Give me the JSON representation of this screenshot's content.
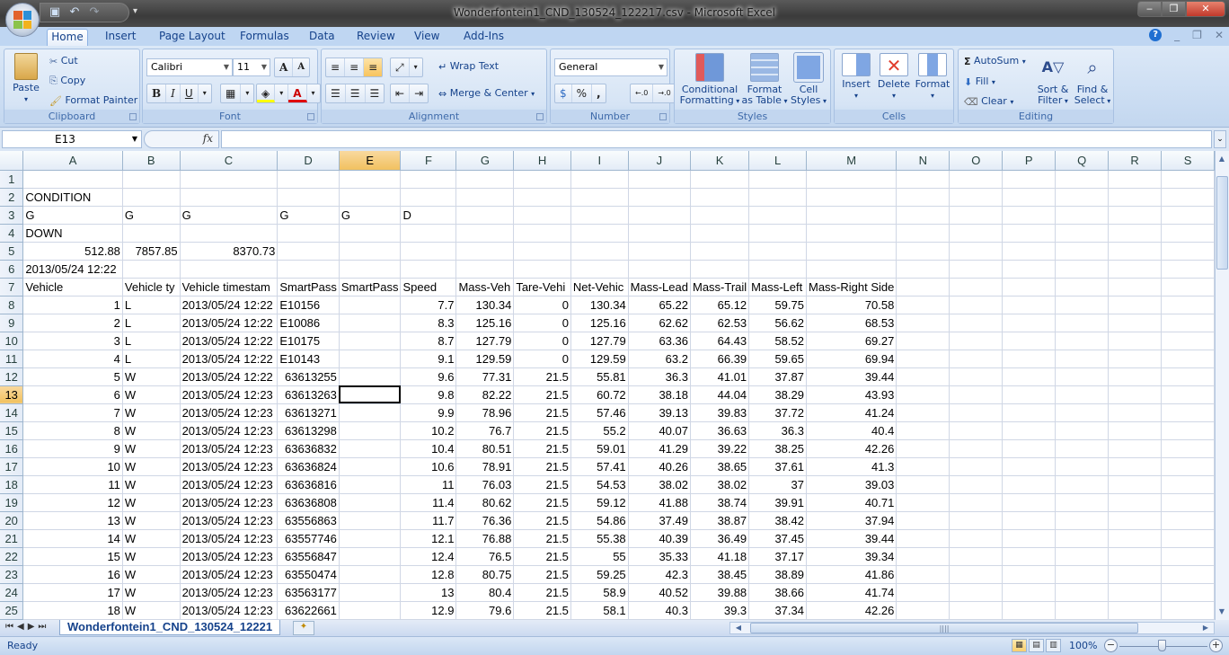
{
  "window": {
    "title": "Wonderfontein1_CND_130524_122217.csv - Microsoft Excel",
    "controls": {
      "minimize": "‒",
      "restore": "❐",
      "close": "✕"
    }
  },
  "quick_access": {
    "save": "save-icon",
    "undo": "undo-icon",
    "redo": "redo-icon",
    "more": "▾"
  },
  "tabs": [
    "Home",
    "Insert",
    "Page Layout",
    "Formulas",
    "Data",
    "Review",
    "View",
    "Add-Ins"
  ],
  "active_tab": "Home",
  "ribbon": {
    "clipboard": {
      "label": "Clipboard",
      "paste": "Paste",
      "cut": "Cut",
      "copy": "Copy",
      "format_painter": "Format Painter"
    },
    "font": {
      "label": "Font",
      "font_name": "Calibri",
      "font_size": "11",
      "grow": "A",
      "shrink": "A",
      "bold": "B",
      "italic": "I",
      "underline": "U"
    },
    "alignment": {
      "label": "Alignment",
      "wrap_text": "Wrap Text",
      "merge_center": "Merge & Center"
    },
    "number": {
      "label": "Number",
      "format": "General",
      "percent": "%",
      "comma": ",",
      "inc_decimal": "←.0 .00",
      "dec_decimal": ".00 →.0"
    },
    "styles": {
      "label": "Styles",
      "conditional": "Conditional",
      "conditional2": "Formatting",
      "format_table": "Format",
      "format_table2": "as Table",
      "cell_styles": "Cell",
      "cell_styles2": "Styles"
    },
    "cells": {
      "label": "Cells",
      "insert": "Insert",
      "delete": "Delete",
      "format": "Format"
    },
    "editing": {
      "label": "Editing",
      "autosum": "AutoSum",
      "fill": "Fill",
      "clear": "Clear",
      "sort": "Sort &",
      "sort2": "Filter",
      "find": "Find &",
      "find2": "Select"
    }
  },
  "formula_bar": {
    "name_box": "E13",
    "fx": "fx",
    "formula": ""
  },
  "columns": [
    "A",
    "B",
    "C",
    "D",
    "E",
    "F",
    "G",
    "H",
    "I",
    "J",
    "K",
    "L",
    "M",
    "N",
    "O",
    "P",
    "Q",
    "R",
    "S"
  ],
  "selected_cell": {
    "col": "E",
    "row": 13
  },
  "rows": [
    {
      "n": "1",
      "cells": [
        "",
        "",
        "",
        "",
        "",
        "",
        "",
        "",
        "",
        "",
        "",
        "",
        ""
      ]
    },
    {
      "n": "2",
      "cells": [
        "CONDITION",
        "",
        "",
        "",
        "",
        "",
        "",
        "",
        "",
        "",
        "",
        "",
        ""
      ]
    },
    {
      "n": "3",
      "cells": [
        "G",
        "G",
        "G",
        "G",
        "G",
        "D",
        "",
        "",
        "",
        "",
        "",
        "",
        ""
      ]
    },
    {
      "n": "4",
      "cells": [
        "DOWN",
        "",
        "",
        "",
        "",
        "",
        "",
        "",
        "",
        "",
        "",
        "",
        ""
      ]
    },
    {
      "n": "5",
      "cells": [
        "512.88",
        "7857.85",
        "8370.73",
        "",
        "",
        "",
        "",
        "",
        "",
        "",
        "",
        "",
        ""
      ]
    },
    {
      "n": "6",
      "cells": [
        " 2013/05/24 12:22",
        "",
        "",
        "",
        "",
        "",
        "",
        "",
        "",
        "",
        "",
        "",
        ""
      ]
    },
    {
      "n": "7",
      "cells": [
        "Vehicle",
        "Vehicle ty",
        "Vehicle timestam",
        "SmartPass",
        "SmartPass",
        "Speed",
        "Mass-Veh",
        "Tare-Vehi",
        "Net-Vehic",
        "Mass-Lead",
        "Mass-Trail",
        "Mass-Left",
        "Mass-Right Side"
      ]
    },
    {
      "n": "8",
      "cells": [
        "1",
        "L",
        "2013/05/24 12:22",
        "E10156",
        "",
        "7.7",
        "130.34",
        "0",
        "130.34",
        "65.22",
        "65.12",
        "59.75",
        "70.58"
      ]
    },
    {
      "n": "9",
      "cells": [
        "2",
        "L",
        "2013/05/24 12:22",
        "E10086",
        "",
        "8.3",
        "125.16",
        "0",
        "125.16",
        "62.62",
        "62.53",
        "56.62",
        "68.53"
      ]
    },
    {
      "n": "10",
      "cells": [
        "3",
        "L",
        "2013/05/24 12:22",
        "E10175",
        "",
        "8.7",
        "127.79",
        "0",
        "127.79",
        "63.36",
        "64.43",
        "58.52",
        "69.27"
      ]
    },
    {
      "n": "11",
      "cells": [
        "4",
        "L",
        "2013/05/24 12:22",
        "E10143",
        "",
        "9.1",
        "129.59",
        "0",
        "129.59",
        "63.2",
        "66.39",
        "59.65",
        "69.94"
      ]
    },
    {
      "n": "12",
      "cells": [
        "5",
        "W",
        "2013/05/24 12:22",
        "63613255",
        "",
        "9.6",
        "77.31",
        "21.5",
        "55.81",
        "36.3",
        "41.01",
        "37.87",
        "39.44"
      ]
    },
    {
      "n": "13",
      "cells": [
        "6",
        "W",
        "2013/05/24 12:23",
        "63613263",
        "",
        "9.8",
        "82.22",
        "21.5",
        "60.72",
        "38.18",
        "44.04",
        "38.29",
        "43.93"
      ]
    },
    {
      "n": "14",
      "cells": [
        "7",
        "W",
        "2013/05/24 12:23",
        "63613271",
        "",
        "9.9",
        "78.96",
        "21.5",
        "57.46",
        "39.13",
        "39.83",
        "37.72",
        "41.24"
      ]
    },
    {
      "n": "15",
      "cells": [
        "8",
        "W",
        "2013/05/24 12:23",
        "63613298",
        "",
        "10.2",
        "76.7",
        "21.5",
        "55.2",
        "40.07",
        "36.63",
        "36.3",
        "40.4"
      ]
    },
    {
      "n": "16",
      "cells": [
        "9",
        "W",
        "2013/05/24 12:23",
        "63636832",
        "",
        "10.4",
        "80.51",
        "21.5",
        "59.01",
        "41.29",
        "39.22",
        "38.25",
        "42.26"
      ]
    },
    {
      "n": "17",
      "cells": [
        "10",
        "W",
        "2013/05/24 12:23",
        "63636824",
        "",
        "10.6",
        "78.91",
        "21.5",
        "57.41",
        "40.26",
        "38.65",
        "37.61",
        "41.3"
      ]
    },
    {
      "n": "18",
      "cells": [
        "11",
        "W",
        "2013/05/24 12:23",
        "63636816",
        "",
        "11",
        "76.03",
        "21.5",
        "54.53",
        "38.02",
        "38.02",
        "37",
        "39.03"
      ]
    },
    {
      "n": "19",
      "cells": [
        "12",
        "W",
        "2013/05/24 12:23",
        "63636808",
        "",
        "11.4",
        "80.62",
        "21.5",
        "59.12",
        "41.88",
        "38.74",
        "39.91",
        "40.71"
      ]
    },
    {
      "n": "20",
      "cells": [
        "13",
        "W",
        "2013/05/24 12:23",
        "63556863",
        "",
        "11.7",
        "76.36",
        "21.5",
        "54.86",
        "37.49",
        "38.87",
        "38.42",
        "37.94"
      ]
    },
    {
      "n": "21",
      "cells": [
        "14",
        "W",
        "2013/05/24 12:23",
        "63557746",
        "",
        "12.1",
        "76.88",
        "21.5",
        "55.38",
        "40.39",
        "36.49",
        "37.45",
        "39.44"
      ]
    },
    {
      "n": "22",
      "cells": [
        "15",
        "W",
        "2013/05/24 12:23",
        "63556847",
        "",
        "12.4",
        "76.5",
        "21.5",
        "55",
        "35.33",
        "41.18",
        "37.17",
        "39.34"
      ]
    },
    {
      "n": "23",
      "cells": [
        "16",
        "W",
        "2013/05/24 12:23",
        "63550474",
        "",
        "12.8",
        "80.75",
        "21.5",
        "59.25",
        "42.3",
        "38.45",
        "38.89",
        "41.86"
      ]
    },
    {
      "n": "24",
      "cells": [
        "17",
        "W",
        "2013/05/24 12:23",
        "63563177",
        "",
        "13",
        "80.4",
        "21.5",
        "58.9",
        "40.52",
        "39.88",
        "38.66",
        "41.74"
      ]
    },
    {
      "n": "25",
      "cells": [
        "18",
        "W",
        "2013/05/24 12:23",
        "63622661",
        "",
        "12.9",
        "79.6",
        "21.5",
        "58.1",
        "40.3",
        "39.3",
        "37.34",
        "42.26"
      ]
    }
  ],
  "sheet_tab": "Wonderfontein1_CND_130524_12221",
  "status": {
    "text": "Ready",
    "zoom": "100%",
    "zoom_level_percent": 100
  }
}
